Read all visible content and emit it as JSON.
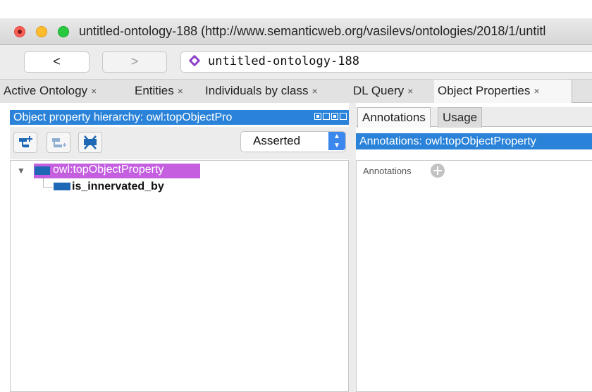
{
  "window": {
    "title": "untitled-ontology-188 (http://www.semanticweb.org/vasilevs/ontologies/2018/1/untitl"
  },
  "nav": {
    "back_label": "<",
    "forward_label": ">",
    "address": "untitled-ontology-188",
    "address_icon": "ontology-diamond-icon"
  },
  "tabs": [
    {
      "label": "Active Ontology",
      "close": "×"
    },
    {
      "label": "Entities",
      "close": "×"
    },
    {
      "label": "Individuals by class",
      "close": "×"
    },
    {
      "label": "DL Query",
      "close": "×"
    },
    {
      "label": "Object Properties",
      "close": "×",
      "active": true
    }
  ],
  "left_panel": {
    "header": "Object property hierarchy: owl:topObjectPro",
    "view_mode": "Asserted",
    "toolbar_icons": [
      "add-sub-property-icon",
      "add-sibling-property-icon",
      "delete-property-icon"
    ],
    "tree": {
      "root": "owl:topObjectProperty",
      "children": [
        "is_innervated_by"
      ]
    }
  },
  "right_panel": {
    "tabs": [
      "Annotations",
      "Usage"
    ],
    "header": "Annotations: owl:topObjectProperty",
    "annotations_label": "Annotations"
  },
  "colors": {
    "header_blue": "#2a83d8",
    "selection_purple": "#c45fe0",
    "property_icon_blue": "#1f68b5"
  }
}
